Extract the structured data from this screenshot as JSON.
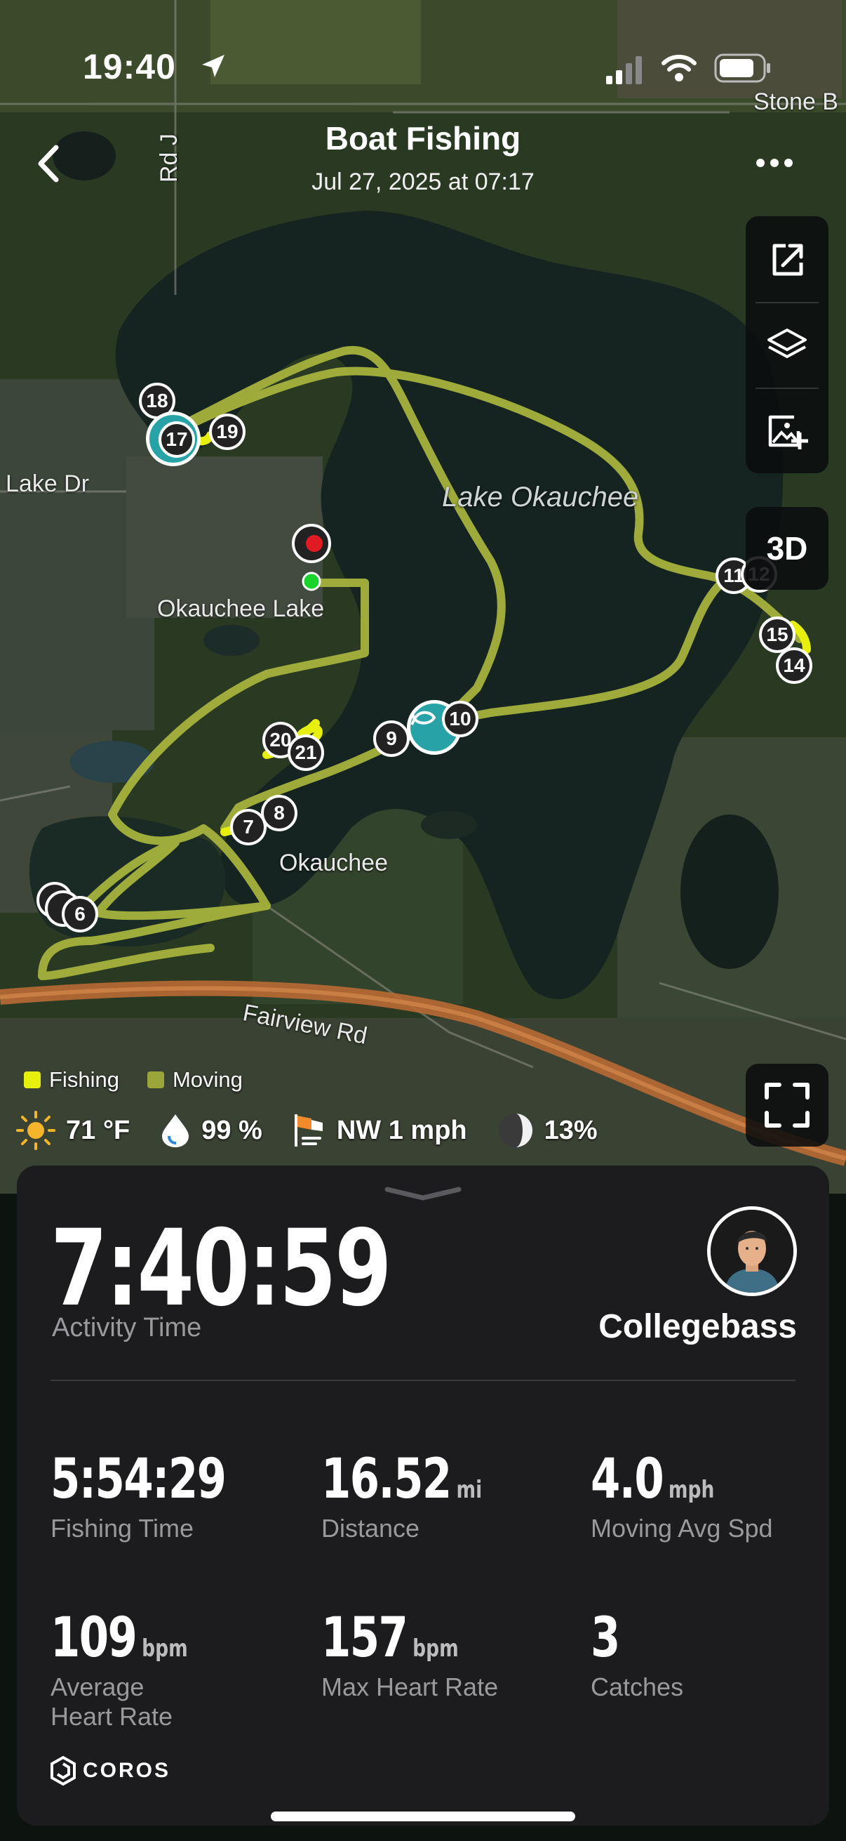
{
  "status_bar": {
    "time": "19:40"
  },
  "header": {
    "title": "Boat Fishing",
    "subtitle": "Jul 27, 2025 at 07:17"
  },
  "map": {
    "labels": {
      "lake": "Lake Okauchee",
      "town1": "Okauchee Lake",
      "town2": "Okauchee",
      "road1": "Lake Dr",
      "road2": "Rd J",
      "road3": "Fairview Rd",
      "road4": "Stone B"
    },
    "markers": [
      "18",
      "17",
      "19",
      "20",
      "21",
      "9",
      "10",
      "7",
      "8",
      "6",
      "11",
      "12",
      "15",
      "14"
    ],
    "toolbar_3d": "3D",
    "legend": {
      "fishing": "Fishing",
      "moving": "Moving",
      "fishing_color": "#e7f00d",
      "moving_color": "#9aa63a"
    }
  },
  "weather": {
    "temp": "71 °F",
    "humidity": "99 %",
    "wind": "NW 1 mph",
    "moon": "13%"
  },
  "summary": {
    "activity_time": "7:40:59",
    "activity_time_label": "Activity Time",
    "username": "Collegebass",
    "stats": [
      {
        "value": "5:54:29",
        "unit": "",
        "label": "Fishing Time"
      },
      {
        "value": "16.52",
        "unit": "mi",
        "label": "Distance"
      },
      {
        "value": "4.0",
        "unit": "mph",
        "label": "Moving Avg Spd"
      },
      {
        "value": "109",
        "unit": "bpm",
        "label": "Average Heart Rate"
      },
      {
        "value": "157",
        "unit": "bpm",
        "label": "Max Heart Rate"
      },
      {
        "value": "3",
        "unit": "",
        "label": "Catches"
      }
    ],
    "brand": "COROS"
  }
}
